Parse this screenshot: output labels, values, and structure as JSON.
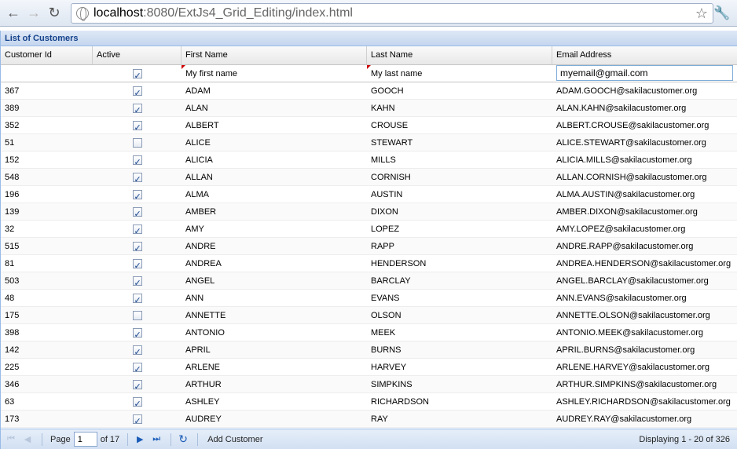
{
  "browser": {
    "back_icon": "←",
    "forward_icon": "→",
    "reload_icon": "↻",
    "url_host": "localhost",
    "url_rest": ":8080/ExtJs4_Grid_Editing/index.html",
    "star_icon": "☆",
    "wrench_icon": "🔧"
  },
  "panel": {
    "title": "List of Customers"
  },
  "columns": [
    "Customer Id",
    "Active",
    "First Name",
    "Last Name",
    "Email Address"
  ],
  "edit_row": {
    "customer_id": "",
    "active": true,
    "first_name": "My first name",
    "last_name": "My last name",
    "email": "myemail@gmail.com"
  },
  "rows": [
    {
      "id": "367",
      "active": true,
      "first": "ADAM",
      "last": "GOOCH",
      "email": "ADAM.GOOCH@sakilacustomer.org"
    },
    {
      "id": "389",
      "active": true,
      "first": "ALAN",
      "last": "KAHN",
      "email": "ALAN.KAHN@sakilacustomer.org"
    },
    {
      "id": "352",
      "active": true,
      "first": "ALBERT",
      "last": "CROUSE",
      "email": "ALBERT.CROUSE@sakilacustomer.org"
    },
    {
      "id": "51",
      "active": false,
      "first": "ALICE",
      "last": "STEWART",
      "email": "ALICE.STEWART@sakilacustomer.org"
    },
    {
      "id": "152",
      "active": true,
      "first": "ALICIA",
      "last": "MILLS",
      "email": "ALICIA.MILLS@sakilacustomer.org"
    },
    {
      "id": "548",
      "active": true,
      "first": "ALLAN",
      "last": "CORNISH",
      "email": "ALLAN.CORNISH@sakilacustomer.org"
    },
    {
      "id": "196",
      "active": true,
      "first": "ALMA",
      "last": "AUSTIN",
      "email": "ALMA.AUSTIN@sakilacustomer.org"
    },
    {
      "id": "139",
      "active": true,
      "first": "AMBER",
      "last": "DIXON",
      "email": "AMBER.DIXON@sakilacustomer.org"
    },
    {
      "id": "32",
      "active": true,
      "first": "AMY",
      "last": "LOPEZ",
      "email": "AMY.LOPEZ@sakilacustomer.org"
    },
    {
      "id": "515",
      "active": true,
      "first": "ANDRE",
      "last": "RAPP",
      "email": "ANDRE.RAPP@sakilacustomer.org"
    },
    {
      "id": "81",
      "active": true,
      "first": "ANDREA",
      "last": "HENDERSON",
      "email": "ANDREA.HENDERSON@sakilacustomer.org"
    },
    {
      "id": "503",
      "active": true,
      "first": "ANGEL",
      "last": "BARCLAY",
      "email": "ANGEL.BARCLAY@sakilacustomer.org"
    },
    {
      "id": "48",
      "active": true,
      "first": "ANN",
      "last": "EVANS",
      "email": "ANN.EVANS@sakilacustomer.org"
    },
    {
      "id": "175",
      "active": false,
      "first": "ANNETTE",
      "last": "OLSON",
      "email": "ANNETTE.OLSON@sakilacustomer.org"
    },
    {
      "id": "398",
      "active": true,
      "first": "ANTONIO",
      "last": "MEEK",
      "email": "ANTONIO.MEEK@sakilacustomer.org"
    },
    {
      "id": "142",
      "active": true,
      "first": "APRIL",
      "last": "BURNS",
      "email": "APRIL.BURNS@sakilacustomer.org"
    },
    {
      "id": "225",
      "active": true,
      "first": "ARLENE",
      "last": "HARVEY",
      "email": "ARLENE.HARVEY@sakilacustomer.org"
    },
    {
      "id": "346",
      "active": true,
      "first": "ARTHUR",
      "last": "SIMPKINS",
      "email": "ARTHUR.SIMPKINS@sakilacustomer.org"
    },
    {
      "id": "63",
      "active": true,
      "first": "ASHLEY",
      "last": "RICHARDSON",
      "email": "ASHLEY.RICHARDSON@sakilacustomer.org"
    },
    {
      "id": "173",
      "active": true,
      "first": "AUDREY",
      "last": "RAY",
      "email": "AUDREY.RAY@sakilacustomer.org"
    }
  ],
  "pager": {
    "first_icon": "⏮",
    "prev_icon": "◀",
    "page_label": "Page",
    "page_value": "1",
    "of_label": "of 17",
    "next_icon": "▶",
    "last_icon": "⏭",
    "refresh_icon": "↻",
    "add_label": "Add Customer",
    "display_info": "Displaying 1 - 20 of 326"
  }
}
